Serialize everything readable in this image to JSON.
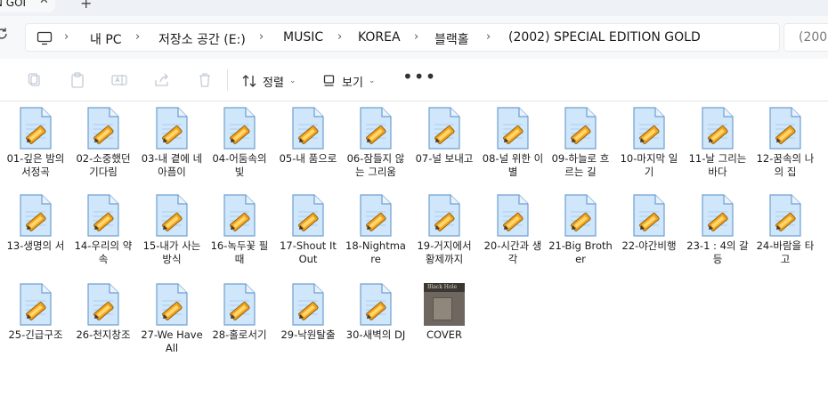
{
  "tab": {
    "title": "N GOI",
    "close": "✕",
    "new": "+"
  },
  "address": {
    "crumbs": [
      "내 PC",
      "저장소 공간 (E:)",
      "MUSIC",
      "KOREA",
      "블랙홀",
      "(2002) SPECIAL EDITION GOLD"
    ],
    "separator": "›",
    "search_placeholder": "(2002"
  },
  "toolbar": {
    "sort_label": "정렬",
    "view_label": "보기",
    "more_label": "•••",
    "caret": "⌄"
  },
  "files": [
    {
      "label": "01-깊은 밤의 서정곡",
      "type": "audio"
    },
    {
      "label": "02-소중했던 기다림",
      "type": "audio"
    },
    {
      "label": "03-내 곁에 네 아픔이",
      "type": "audio"
    },
    {
      "label": "04-어둠속의 빛",
      "type": "audio"
    },
    {
      "label": "05-내 품으로",
      "type": "audio"
    },
    {
      "label": "06-잠들지 않는 그리움",
      "type": "audio"
    },
    {
      "label": "07-널 보내고",
      "type": "audio"
    },
    {
      "label": "08-널 위한 이별",
      "type": "audio"
    },
    {
      "label": "09-하늘로 흐르는 길",
      "type": "audio"
    },
    {
      "label": "10-마지막 일기",
      "type": "audio"
    },
    {
      "label": "11-날 그리는 바다",
      "type": "audio"
    },
    {
      "label": "12-꿈속의 나의 집",
      "type": "audio"
    },
    {
      "label": "13-생명의 서",
      "type": "audio"
    },
    {
      "label": "14-우리의 약속",
      "type": "audio"
    },
    {
      "label": "15-내가 사는 방식",
      "type": "audio"
    },
    {
      "label": "16-녹두꽃 필 때",
      "type": "audio"
    },
    {
      "label": "17-Shout It Out",
      "type": "audio"
    },
    {
      "label": "18-Nightmare",
      "type": "audio"
    },
    {
      "label": "19-거지에서 황제까지",
      "type": "audio"
    },
    {
      "label": "20-시간과 생각",
      "type": "audio"
    },
    {
      "label": "21-Big Brother",
      "type": "audio"
    },
    {
      "label": "22-야간비행",
      "type": "audio"
    },
    {
      "label": "23-1 : 4의 갈등",
      "type": "audio"
    },
    {
      "label": "24-바람을 타고",
      "type": "audio"
    },
    {
      "label": "25-긴급구조",
      "type": "audio"
    },
    {
      "label": "26-천지창조",
      "type": "audio"
    },
    {
      "label": "27-We Have All",
      "type": "audio"
    },
    {
      "label": "28-홀로서기",
      "type": "audio"
    },
    {
      "label": "29-낙원탈출",
      "type": "audio"
    },
    {
      "label": "30-새벽의 DJ",
      "type": "audio"
    },
    {
      "label": "COVER",
      "type": "image",
      "thumb_text": "Black Hole"
    }
  ]
}
